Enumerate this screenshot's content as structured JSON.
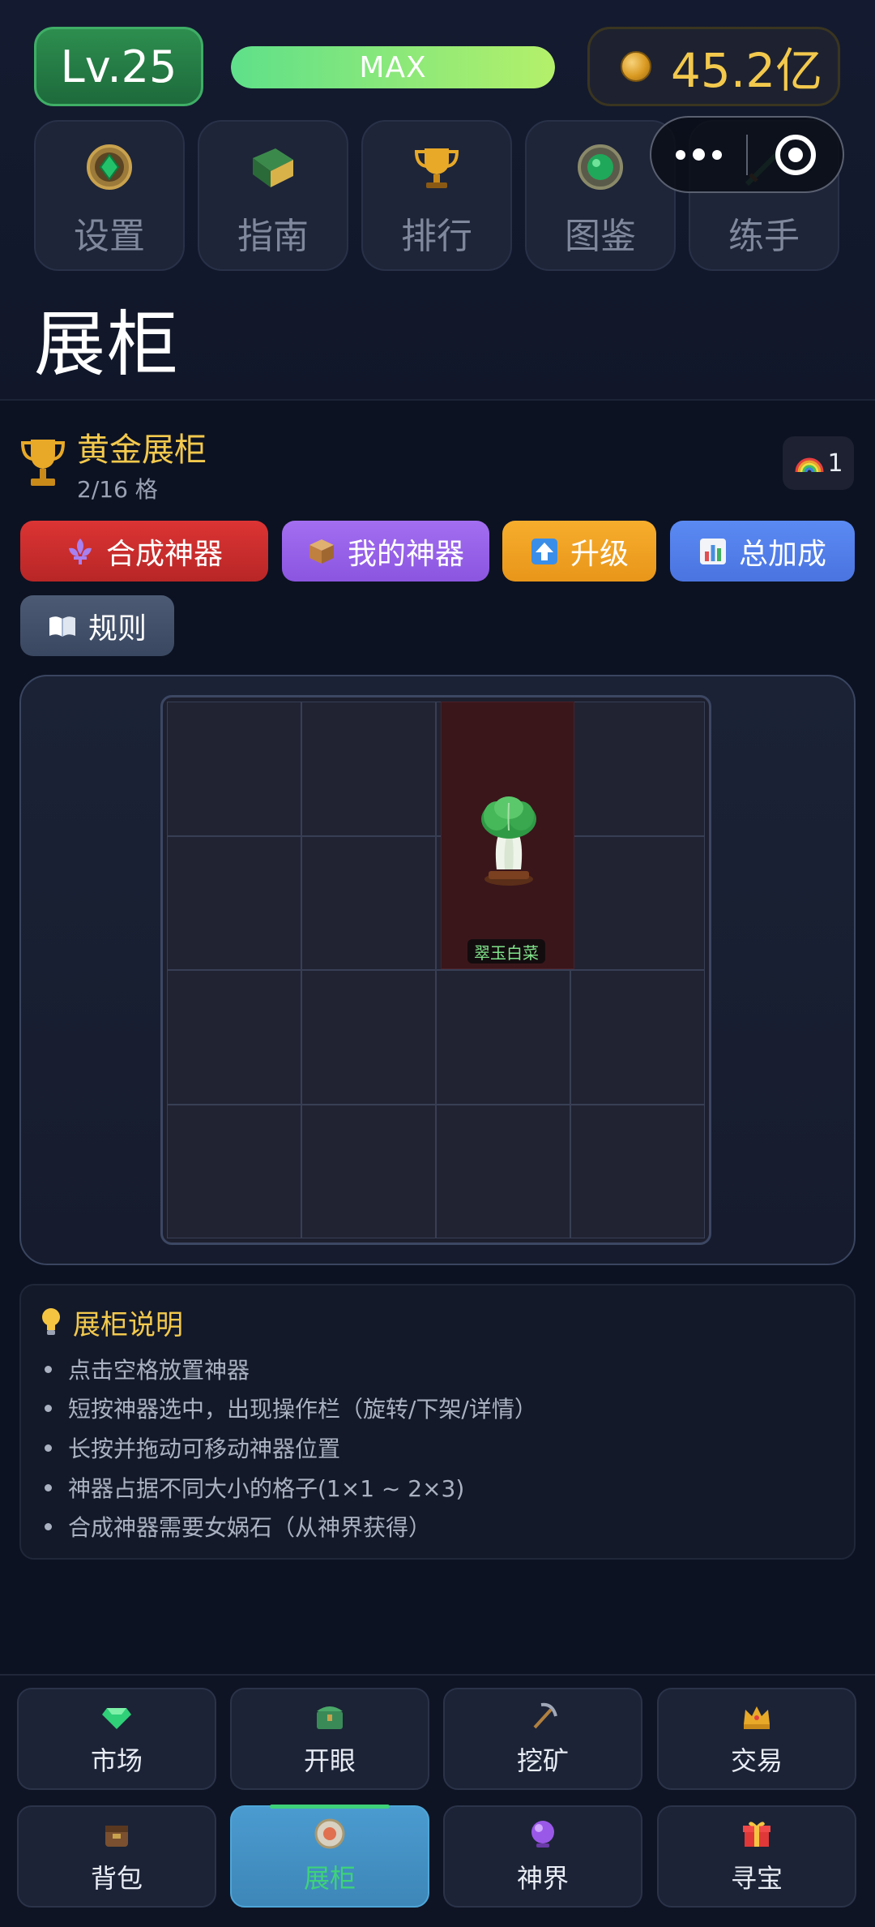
{
  "header": {
    "level": "Lv.25",
    "xp_label": "MAX",
    "xp_progress": 1.0,
    "coins": "45.2亿"
  },
  "menu": [
    {
      "label": "设置",
      "icon": "emerald-medallion-icon"
    },
    {
      "label": "指南",
      "icon": "guide-book-icon"
    },
    {
      "label": "排行",
      "icon": "trophy-icon"
    },
    {
      "label": "图鉴",
      "icon": "green-gem-icon"
    },
    {
      "label": "练手",
      "icon": "sword-icon"
    }
  ],
  "page_title": "展柜",
  "cabinet": {
    "name": "黄金展柜",
    "slots": "2/16 格",
    "rainbow_count": "1"
  },
  "actions": {
    "compose": "合成神器",
    "my_artifacts": "我的神器",
    "upgrade": "升级",
    "total_bonus": "总加成",
    "rules": "规则"
  },
  "grid": {
    "rows": 4,
    "cols": 4,
    "item": {
      "name": "翠玉白菜",
      "icon": "jade-cabbage-icon",
      "col": 3,
      "row": 1,
      "width_cells": 1,
      "height_cells": 2
    }
  },
  "description": {
    "title": "展柜说明",
    "items": [
      "点击空格放置神器",
      "短按神器选中，出现操作栏（旋转/下架/详情）",
      "长按并拖动可移动神器位置",
      "神器占据不同大小的格子(1×1 ~ 2×3)",
      "合成神器需要女娲石（从神界获得）"
    ]
  },
  "bottom_nav": [
    {
      "label": "市场",
      "icon": "diamond-icon"
    },
    {
      "label": "开眼",
      "icon": "jade-chest-icon"
    },
    {
      "label": "挖矿",
      "icon": "pickaxe-icon"
    },
    {
      "label": "交易",
      "icon": "crown-icon"
    },
    {
      "label": "背包",
      "icon": "backpack-icon"
    },
    {
      "label": "展柜",
      "icon": "cabinet-icon",
      "active": true
    },
    {
      "label": "神界",
      "icon": "purple-orb-icon"
    },
    {
      "label": "寻宝",
      "icon": "gift-icon"
    }
  ],
  "colors": {
    "background": "#0c1222",
    "gold": "#f3c94d",
    "level_green": "#2d8e4f",
    "active_tab": "#4b9bd0",
    "active_label": "#3ed27a"
  }
}
